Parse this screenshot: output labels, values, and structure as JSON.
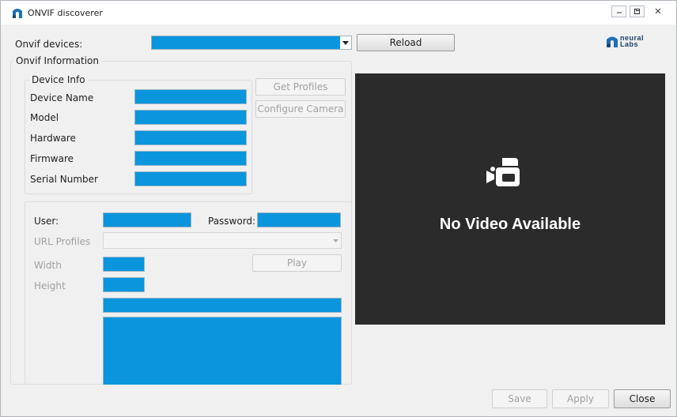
{
  "window": {
    "title": "ONVIF discoverer"
  },
  "logo": {
    "line1": "neural",
    "line2": "Labs"
  },
  "devices": {
    "label": "Onvif devices:",
    "reload": "Reload"
  },
  "onvif_info": {
    "title": "Onvif Information",
    "device_info": {
      "title": "Device Info",
      "device_name": "Device Name",
      "model": "Model",
      "hardware": "Hardware",
      "firmware": "Firmware",
      "serial": "Serial Number"
    },
    "get_profiles": "Get Profiles",
    "configure_camera": "Configure Camera"
  },
  "credentials": {
    "user": "User:",
    "password": "Password:",
    "url_profiles": "URL Profiles",
    "width": "Width",
    "height": "Height",
    "play": "Play"
  },
  "video": {
    "message": "No Video Available",
    "icon": "video-camera-icon"
  },
  "footer": {
    "save": "Save",
    "apply": "Apply",
    "close": "Close"
  },
  "colors": {
    "field": "#0a95dc",
    "video_bg": "#2b2b2b",
    "window_bg": "#f0f0f0"
  }
}
